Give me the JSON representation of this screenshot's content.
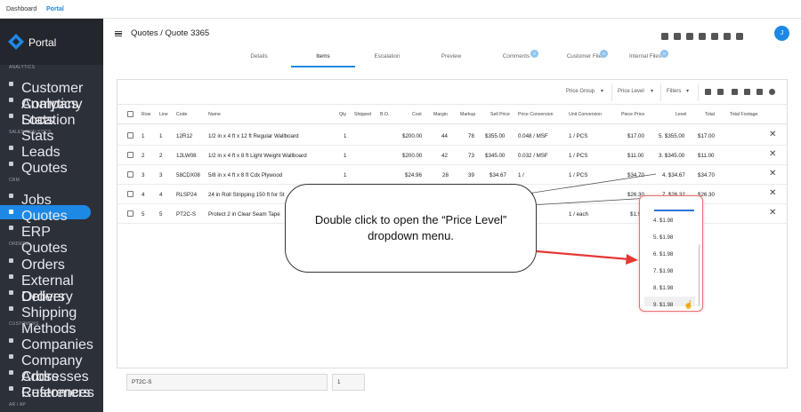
{
  "topbar": {
    "dashboard": "Dashboard",
    "portal": "Portal"
  },
  "sidebar": {
    "logo": "Portal",
    "items": [
      {
        "section": "ANALYTICS"
      },
      {
        "label": "Customer Analytics",
        "icon": "analytics-icon"
      },
      {
        "label": "Company Stats",
        "icon": "stats-icon"
      },
      {
        "label": "Location Stats",
        "icon": "stats-icon"
      },
      {
        "section": "SALES ANALYTICS"
      },
      {
        "label": "Leads",
        "icon": "leads-icon"
      },
      {
        "label": "Quotes",
        "icon": "quotes-icon"
      },
      {
        "section": "CRM"
      },
      {
        "label": "Jobs",
        "icon": "pin-icon"
      },
      {
        "label": "Quotes",
        "icon": "quotes-icon",
        "active": true
      },
      {
        "label": "ERP Quotes",
        "icon": "quotes-icon"
      },
      {
        "section": "ORDERS"
      },
      {
        "label": "Orders",
        "icon": "truck-icon"
      },
      {
        "label": "External Orders",
        "icon": "check-icon"
      },
      {
        "label": "Delivery",
        "icon": "delivery-icon"
      },
      {
        "label": "Shipping Methods",
        "icon": "shipping-icon"
      },
      {
        "section": "CUSTOMERS"
      },
      {
        "label": "Companies",
        "icon": "building-icon"
      },
      {
        "label": "Company Addresses",
        "icon": "pin-icon"
      },
      {
        "label": "Cross References",
        "icon": "link-icon"
      },
      {
        "label": "Customers",
        "icon": "people-icon"
      },
      {
        "section": "AR / AP"
      }
    ]
  },
  "header": {
    "title": "Quotes / Quote 3365",
    "avatar": "J",
    "icons": [
      "location-icon",
      "truck-icon",
      "card-icon",
      "mail-icon",
      "copy-icon",
      "file-icon",
      "attachment-icon"
    ]
  },
  "tabs": [
    {
      "label": "Details"
    },
    {
      "label": "Items",
      "active": true
    },
    {
      "label": "Escalation"
    },
    {
      "label": "Preview"
    },
    {
      "label": "Comments",
      "badge": "0"
    },
    {
      "label": "Customer Files",
      "badge": "0"
    },
    {
      "label": "Internal Files",
      "badge": "0"
    }
  ],
  "filters": {
    "price_group": "Price Group",
    "price_level": "Price Level",
    "filters": "Filters"
  },
  "table": {
    "headers": [
      "Row",
      "Line",
      "Code",
      "Name",
      "Qty",
      "Shipped",
      "B.O.",
      "Cost",
      "Margin",
      "Markup",
      "Sell Price",
      "Price Conversion",
      "Unit Conversion",
      "Piece Price",
      "Level",
      "Total",
      "Total Footage"
    ],
    "rows": [
      {
        "row": "1",
        "line": "1",
        "code": "12R12",
        "name": "1/2 in x 4 ft x 12 ft Regular Wallboard",
        "qty": "1",
        "cost": "$200.00",
        "margin": "44",
        "markup": "78",
        "sell": "$355.00",
        "pconv": "0.048 / MSF",
        "uconv": "1 / PCS",
        "piece": "$17.00",
        "level": "5. $355.00",
        "total": "$17.00"
      },
      {
        "row": "2",
        "line": "2",
        "code": "12LW08",
        "name": "1/2 in x 4 ft x 8 ft Light Weight Wallboard",
        "qty": "1",
        "cost": "$200.00",
        "margin": "42",
        "markup": "73",
        "sell": "$345.00",
        "pconv": "0.032 / MSF",
        "uconv": "1 / PCS",
        "piece": "$11.00",
        "level": "3. $345.00",
        "total": "$11.00"
      },
      {
        "row": "3",
        "line": "3",
        "code": "58CDX08",
        "name": "5/8 in x 4 ft x 8 ft Cdx Plywood",
        "qty": "1",
        "cost": "$24.96",
        "margin": "28",
        "markup": "39",
        "sell": "$34.67",
        "pconv": "1 /",
        "uconv": "1 / PCS",
        "piece": "$34.70",
        "level": "4. $34.67",
        "total": "$34.70"
      },
      {
        "row": "4",
        "line": "4",
        "code": "RLSP24",
        "name": "24 in Roll Stripping 150 ft for St",
        "qty": "",
        "cost": "",
        "margin": "",
        "markup": "",
        "sell": "",
        "pconv": "th",
        "uconv": "",
        "piece": "$26.30",
        "level": "7. $26.32",
        "total": "$26.30"
      },
      {
        "row": "5",
        "line": "5",
        "code": "PT2C-S",
        "name": "Protect 2 in Clear Seam Tape",
        "qty": "",
        "cost": "",
        "margin": "",
        "markup": "",
        "sell": "",
        "pconv": "",
        "uconv": "1 / each",
        "piece": "$1.98",
        "level": "",
        "total": ""
      }
    ]
  },
  "footer": {
    "code_value": "PT2C-S",
    "qty_value": "1"
  },
  "callout": {
    "line1": "Double click to open the “Price Level”",
    "line2": "dropdown menu."
  },
  "dropdown": {
    "options": [
      "4. $1.98",
      "5. $1.98",
      "6. $1.98",
      "7. $1.98",
      "8. $1.98",
      "9. $1.98"
    ]
  },
  "colors": {
    "accent": "#1e88e5",
    "sidebar": "#2c3038",
    "annotation_red": "#e53935"
  }
}
